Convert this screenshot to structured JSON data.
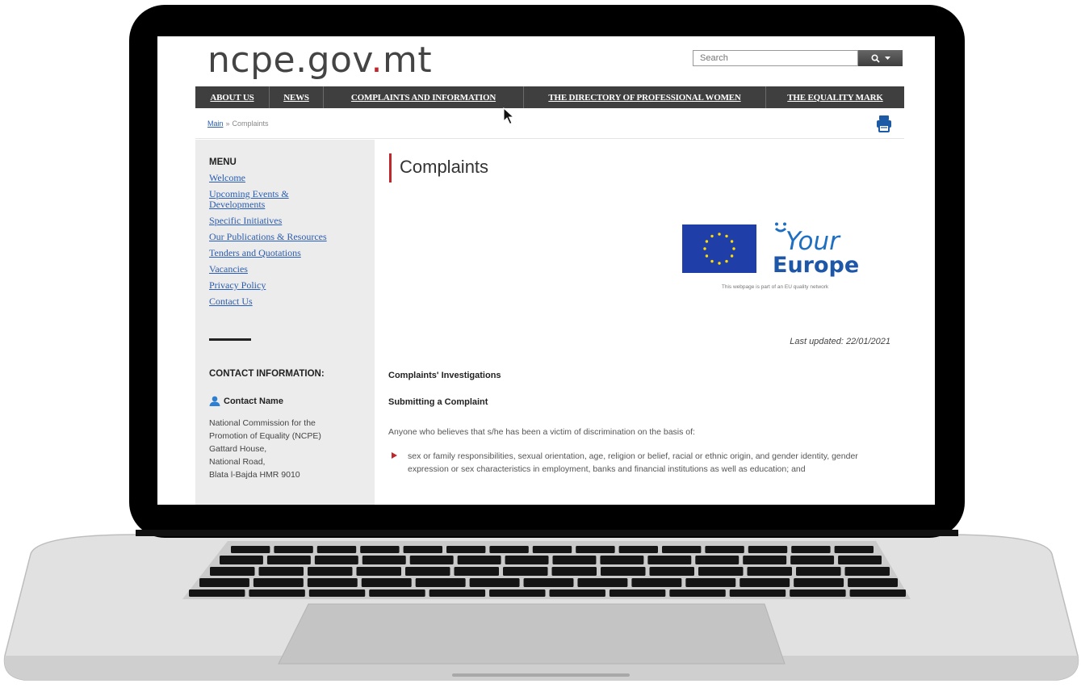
{
  "site": {
    "logo_prefix": "ncpe.gov",
    "logo_dot": ".",
    "logo_suffix": "mt"
  },
  "search": {
    "placeholder": "Search",
    "icon": "search-icon",
    "dropdown_icon": "chevron-down-icon"
  },
  "nav": {
    "items": [
      {
        "label": "ABOUT US"
      },
      {
        "label": "NEWS"
      },
      {
        "label": "COMPLAINTS AND INFORMATION"
      },
      {
        "label": "THE DIRECTORY OF PROFESSIONAL WOMEN"
      },
      {
        "label": "THE EQUALITY MARK"
      }
    ]
  },
  "breadcrumb": {
    "home": "Main",
    "separator": "»",
    "current": "Complaints"
  },
  "sidebar": {
    "menu_heading": "MENU",
    "menu_items": [
      {
        "label": "Welcome"
      },
      {
        "label": "Upcoming Events & Developments"
      },
      {
        "label": "Specific Initiatives"
      },
      {
        "label": "Our Publications & Resources"
      },
      {
        "label": "Tenders and Quotations"
      },
      {
        "label": "Vacancies"
      },
      {
        "label": "Privacy Policy"
      },
      {
        "label": "Contact Us"
      }
    ],
    "contact_heading": "CONTACT INFORMATION:",
    "contact_name": "Contact Name",
    "contact_address": [
      "National Commission for the",
      "Promotion of Equality (NCPE)",
      "Gattard House,",
      "National Road,",
      "Blata l-Bajda HMR 9010"
    ]
  },
  "main": {
    "title": "Complaints",
    "eu_logo": {
      "line1": "Your",
      "line2": "Europe",
      "tagline": "This webpage is part of an EU quality network"
    },
    "last_updated": "Last updated: 22/01/2021",
    "heading_investigations": "Complaints' Investigations",
    "heading_submitting": "Submitting a Complaint",
    "intro": "Anyone who believes that s/he has been a victim of discrimination on the basis of:",
    "bullets": [
      "sex or family responsibilities, sexual orientation, age, religion or belief, racial or ethnic origin, and gender identity, gender expression or sex characteristics in employment, banks and financial institutions as well as education; and"
    ]
  },
  "colors": {
    "accent_red": "#c0272d",
    "nav_bg": "#3f3f3f",
    "link_blue": "#2a5db0",
    "sidebar_bg": "#ececec",
    "eu_blue": "#1f3ea8",
    "your_europe_blue": "#1e6fc1"
  }
}
